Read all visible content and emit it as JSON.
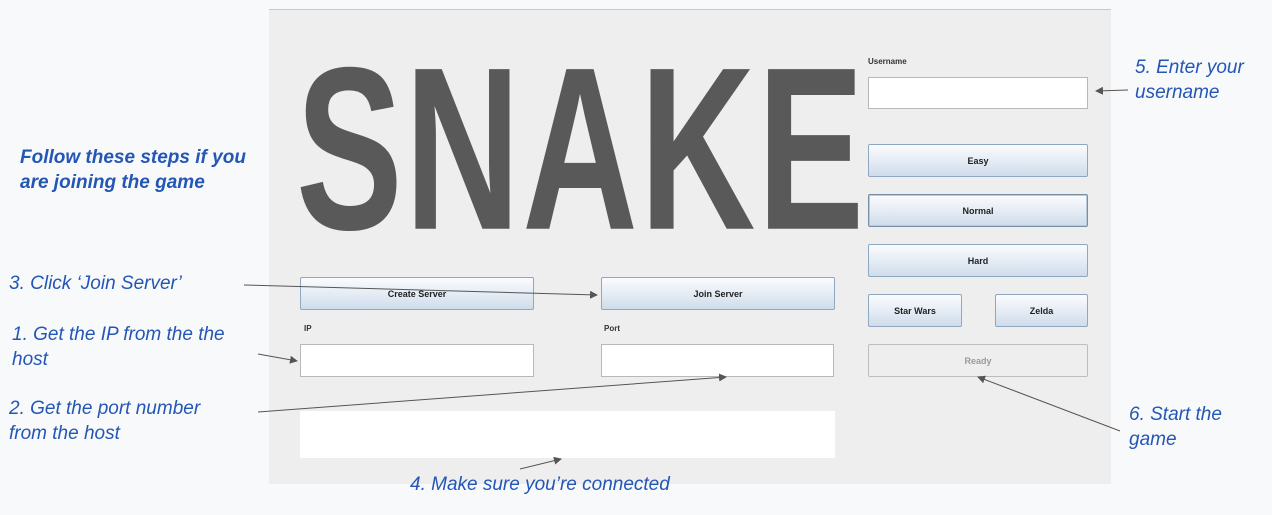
{
  "app": {
    "logo": "SNAKE",
    "buttons": {
      "create_server": "Create Server",
      "join_server": "Join Server",
      "easy": "Easy",
      "normal": "Normal",
      "hard": "Hard",
      "star_wars": "Star Wars",
      "zelda": "Zelda",
      "ready": "Ready"
    },
    "labels": {
      "ip": "IP",
      "port": "Port",
      "username": "Username"
    },
    "fields": {
      "ip_value": "",
      "port_value": "",
      "username_value": "",
      "status_text": ""
    },
    "selected_difficulty": "Normal"
  },
  "annotations": {
    "intro_line1": "Follow these steps if you",
    "intro_line2": "are joining the game",
    "step3": "3. Click ‘Join Server’",
    "step1_line1": "1. Get the IP from the the",
    "step1_line2": "host",
    "step2_line1": "2. Get the port number",
    "step2_line2": "from the host",
    "step4": "4. Make sure you’re connected",
    "step5_line1": "5. Enter your",
    "step5_line2": "username",
    "step6_line1": "6. Start the",
    "step6_line2": "game"
  },
  "colors": {
    "annotation": "#2356b5",
    "logo": "#595959",
    "panel": "#eeeeee"
  }
}
